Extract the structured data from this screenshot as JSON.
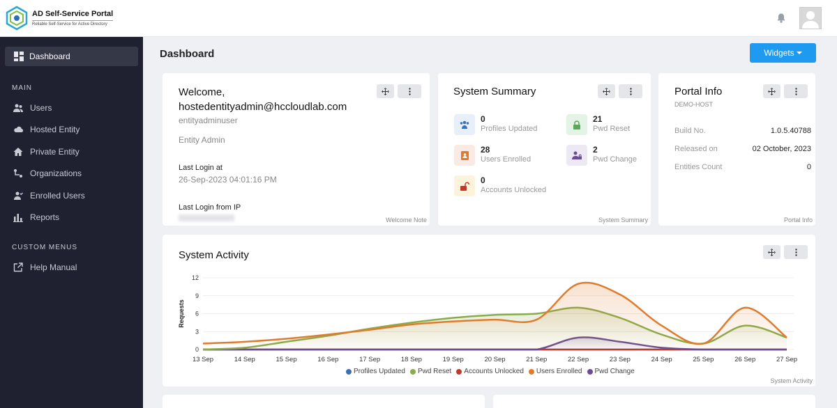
{
  "header": {
    "app_title": "AD Self-Service Portal",
    "app_subtitle": "Reliable Self-Service for Active Directory"
  },
  "sidebar": {
    "active_item": "Dashboard",
    "section_main": "MAIN",
    "items": [
      {
        "label": "Users",
        "icon": "users-icon"
      },
      {
        "label": "Hosted Entity",
        "icon": "cloud-icon"
      },
      {
        "label": "Private Entity",
        "icon": "home-icon"
      },
      {
        "label": "Organizations",
        "icon": "org-icon"
      },
      {
        "label": "Enrolled Users",
        "icon": "enrolled-users-icon"
      },
      {
        "label": "Reports",
        "icon": "reports-icon"
      }
    ],
    "section_custom": "CUSTOM MENUS",
    "custom_items": [
      {
        "label": "Help Manual",
        "icon": "external-link-icon"
      }
    ]
  },
  "main": {
    "title": "Dashboard",
    "widgets_label": "Widgets"
  },
  "welcome": {
    "line1": "Welcome,",
    "line2": "hostedentityadmin@hccloudlab.com",
    "username": "entityadminuser",
    "role": "Entity Admin",
    "last_login_label": "Last Login at",
    "last_login_value": "26-Sep-2023 04:01:16 PM",
    "last_ip_label": "Last Login from IP",
    "footer": "Welcome Note"
  },
  "summary": {
    "title": "System Summary",
    "stats": [
      {
        "value": "0",
        "label": "Profiles Updated"
      },
      {
        "value": "21",
        "label": "Pwd Reset"
      },
      {
        "value": "28",
        "label": "Users Enrolled"
      },
      {
        "value": "2",
        "label": "Pwd Change"
      },
      {
        "value": "0",
        "label": "Accounts Unlocked"
      }
    ],
    "footer": "System Summary"
  },
  "portal": {
    "title": "Portal Info",
    "host": "DEMO-HOST",
    "rows": [
      {
        "key": "Build No.",
        "value": "1.0.5.40788"
      },
      {
        "key": "Released on",
        "value": "02 October, 2023"
      },
      {
        "key": "Entities Count",
        "value": "0"
      }
    ],
    "footer": "Portal Info"
  },
  "activity": {
    "title": "System Activity",
    "footer": "System Activity"
  },
  "colors": {
    "accent": "#1e9bf0",
    "sidebar_bg": "#1f2130",
    "profiles_updated": "#3b6fb6",
    "pwd_reset": "#8aab4a",
    "accounts_unlocked": "#c0392b",
    "users_enrolled": "#e07b2c",
    "pwd_change": "#6a4c93"
  },
  "chart_data": {
    "type": "line",
    "ylabel": "Requests",
    "xlabel": "",
    "ylim": [
      0,
      12
    ],
    "yticks": [
      0,
      3,
      6,
      9,
      12
    ],
    "x": [
      "13 Sep",
      "14 Sep",
      "15 Sep",
      "16 Sep",
      "17 Sep",
      "18 Sep",
      "19 Sep",
      "20 Sep",
      "21 Sep",
      "22 Sep",
      "23 Sep",
      "24 Sep",
      "25 Sep",
      "26 Sep",
      "27 Sep"
    ],
    "series": [
      {
        "name": "Profiles Updated",
        "color": "#3b6fb6",
        "values": [
          0,
          0,
          0,
          0,
          0,
          0,
          0,
          0,
          0,
          0,
          0,
          0,
          0,
          0,
          0
        ]
      },
      {
        "name": "Pwd Reset",
        "color": "#8aab4a",
        "values": [
          0,
          0.3,
          1.3,
          2.3,
          3.5,
          4.5,
          5.3,
          5.8,
          6,
          7,
          5.3,
          2.5,
          1,
          4,
          2
        ]
      },
      {
        "name": "Accounts Unlocked",
        "color": "#c0392b",
        "values": [
          0,
          0,
          0,
          0,
          0,
          0,
          0,
          0,
          0,
          0,
          0,
          0,
          0,
          0,
          0
        ]
      },
      {
        "name": "Users Enrolled",
        "color": "#e07b2c",
        "values": [
          1,
          1.3,
          1.8,
          2.5,
          3.3,
          4.2,
          4.7,
          5,
          5,
          11,
          9.2,
          4,
          1,
          7,
          2
        ]
      },
      {
        "name": "Pwd Change",
        "color": "#6a4c93",
        "values": [
          0,
          0,
          0,
          0,
          0,
          0,
          0,
          0,
          0,
          2,
          1.3,
          0.3,
          0,
          0,
          0
        ]
      }
    ],
    "legend_position": "bottom",
    "grid": true
  }
}
